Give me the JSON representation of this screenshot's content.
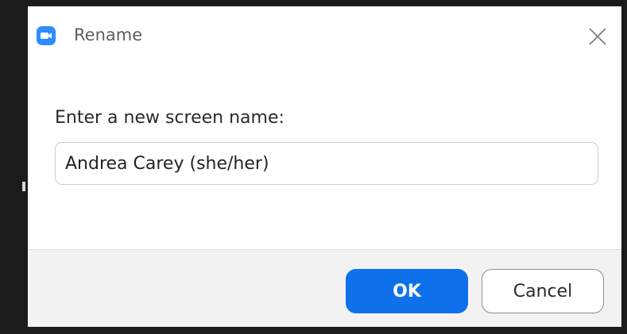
{
  "dialog": {
    "title": "Rename",
    "app_icon": "zoom-camera-icon",
    "close_icon": "close-icon"
  },
  "form": {
    "prompt": "Enter a new screen name:",
    "name_value": "Andrea Carey (she/her)"
  },
  "buttons": {
    "ok_label": "OK",
    "cancel_label": "Cancel"
  },
  "colors": {
    "accent": "#0e71eb",
    "app_icon": "#2d8cff",
    "footer_bg": "#f2f2f2"
  }
}
